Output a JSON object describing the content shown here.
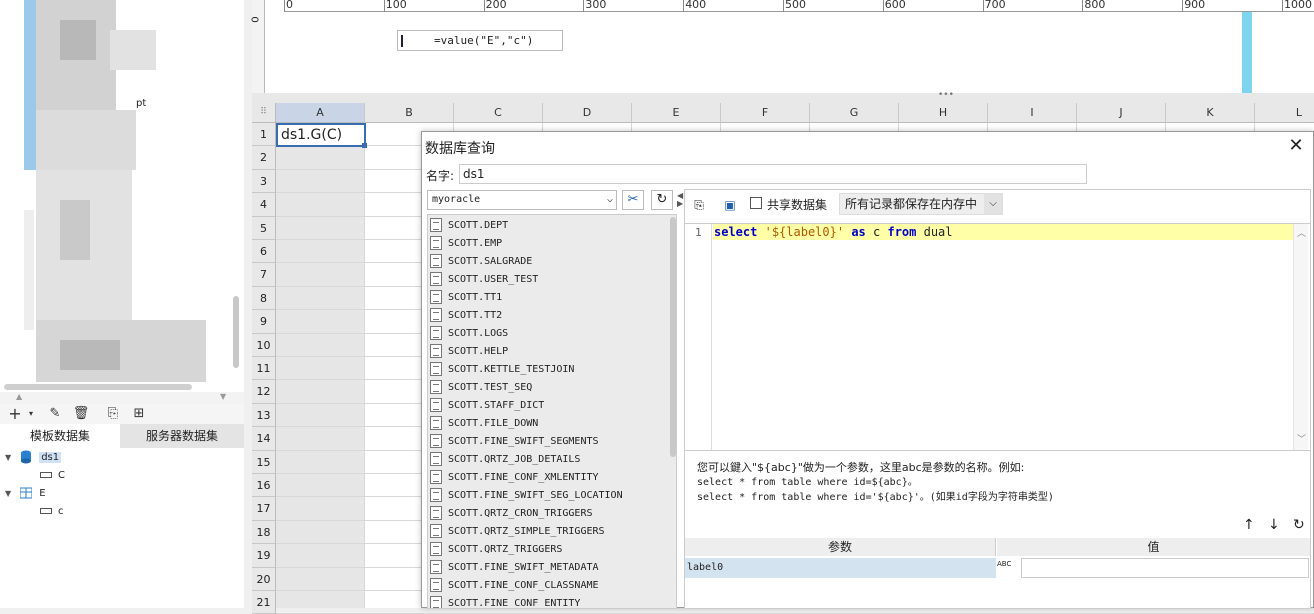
{
  "left_panel": {
    "tree_fragment": "pt",
    "tabs": [
      "模板数据集",
      "服务器数据集"
    ],
    "datasets": [
      {
        "name": "ds1",
        "fields": [
          "C"
        ]
      },
      {
        "name": "E",
        "fields": [
          "c"
        ]
      }
    ]
  },
  "ruler": {
    "vertical_label": "0",
    "ticks": [
      "0",
      "100",
      "200",
      "300",
      "400",
      "500",
      "600",
      "700",
      "800",
      "900",
      "1000"
    ],
    "formula": "=value(\"E\",\"c\")"
  },
  "sheet": {
    "columns": [
      "A",
      "B",
      "C",
      "D",
      "E",
      "F",
      "G",
      "H",
      "I",
      "J",
      "K",
      "L"
    ],
    "rows": [
      "1",
      "2",
      "3",
      "4",
      "5",
      "6",
      "7",
      "8",
      "9",
      "10",
      "11",
      "12",
      "13",
      "14",
      "15",
      "16",
      "17",
      "18",
      "19",
      "20",
      "21"
    ],
    "cell_A1": "ds1.G(C)"
  },
  "dialog": {
    "title": "数据库查询",
    "name_label": "名字:",
    "name_value": "ds1",
    "connection": "myoracle",
    "tables": [
      "SCOTT.DEPT",
      "SCOTT.EMP",
      "SCOTT.SALGRADE",
      "SCOTT.USER_TEST",
      "SCOTT.TT1",
      "SCOTT.TT2",
      "SCOTT.LOGS",
      "SCOTT.HELP",
      "SCOTT.KETTLE_TESTJOIN",
      "SCOTT.TEST_SEQ",
      "SCOTT.STAFF_DICT",
      "SCOTT.FILE_DOWN",
      "SCOTT.FINE_SWIFT_SEGMENTS",
      "SCOTT.QRTZ_JOB_DETAILS",
      "SCOTT.FINE_CONF_XMLENTITY",
      "SCOTT.FINE_SWIFT_SEG_LOCATION",
      "SCOTT.QRTZ_CRON_TRIGGERS",
      "SCOTT.QRTZ_SIMPLE_TRIGGERS",
      "SCOTT.QRTZ_TRIGGERS",
      "SCOTT.FINE_SWIFT_METADATA",
      "SCOTT.FINE_CONF_CLASSNAME",
      "SCOTT.FINE_CONF_ENTITY"
    ],
    "share_label": "共享数据集",
    "memory_option": "所有记录都保存在内存中",
    "sql": {
      "line_number": "1",
      "kw_select": "select",
      "literal": "'${label0}'",
      "kw_as": "as",
      "alias": "c",
      "kw_from": "from",
      "table": "dual"
    },
    "hint_lines": [
      "您可以鍵入\"${abc}\"做为一个参数，这里abc是参数的名称。例如:",
      "select * from table where id=${abc}。",
      "select * from table where id='${abc}'。(如果id字段为字符串类型)"
    ],
    "param_headers": [
      "参数",
      "值"
    ],
    "params": [
      {
        "name": "label0",
        "type_icon": "ABC",
        "value": ""
      }
    ]
  }
}
